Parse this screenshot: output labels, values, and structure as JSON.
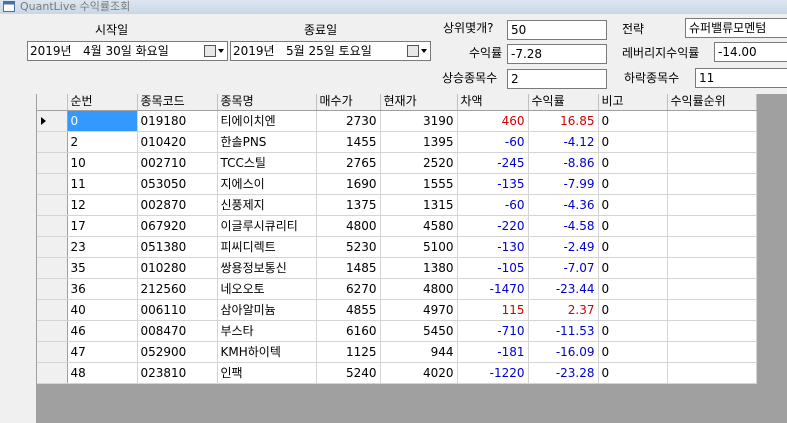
{
  "window": {
    "title": "QuantLive 수익률조회"
  },
  "form": {
    "start_label": "시작일",
    "end_label": "종료일",
    "start_date": "2019년   4월 30일 화요일",
    "end_date": "2019년   5월 25일 토요일",
    "top_n_label": "상위몇개?",
    "top_n_value": "50",
    "return_label": "수익률",
    "return_value": "-7.28",
    "rising_label": "상승종목수",
    "rising_value": "2",
    "strategy_label": "전략",
    "strategy_value": "슈퍼밸류모멘텀",
    "leverage_label": "레버리지수익률",
    "leverage_value": "-14.00",
    "falling_label": "하락종목수",
    "falling_value": "11"
  },
  "grid": {
    "columns": [
      "순번",
      "종목코드",
      "종목명",
      "매수가",
      "현재가",
      "차액",
      "수익률",
      "비고",
      "수익률순위"
    ],
    "rows": [
      {
        "no": "0",
        "code": "019180",
        "name": "티에이치엔",
        "buy": "2730",
        "cur": "3190",
        "diff": "460",
        "ret": "16.85",
        "note": "0",
        "rank": "",
        "sign": "pos"
      },
      {
        "no": "2",
        "code": "010420",
        "name": "한솔PNS",
        "buy": "1455",
        "cur": "1395",
        "diff": "-60",
        "ret": "-4.12",
        "note": "0",
        "rank": "",
        "sign": "neg"
      },
      {
        "no": "10",
        "code": "002710",
        "name": "TCC스틸",
        "buy": "2765",
        "cur": "2520",
        "diff": "-245",
        "ret": "-8.86",
        "note": "0",
        "rank": "",
        "sign": "neg"
      },
      {
        "no": "11",
        "code": "053050",
        "name": "지에스이",
        "buy": "1690",
        "cur": "1555",
        "diff": "-135",
        "ret": "-7.99",
        "note": "0",
        "rank": "",
        "sign": "neg"
      },
      {
        "no": "12",
        "code": "002870",
        "name": "신풍제지",
        "buy": "1375",
        "cur": "1315",
        "diff": "-60",
        "ret": "-4.36",
        "note": "0",
        "rank": "",
        "sign": "neg"
      },
      {
        "no": "17",
        "code": "067920",
        "name": "이글루시큐리티",
        "buy": "4800",
        "cur": "4580",
        "diff": "-220",
        "ret": "-4.58",
        "note": "0",
        "rank": "",
        "sign": "neg"
      },
      {
        "no": "23",
        "code": "051380",
        "name": "피씨디렉트",
        "buy": "5230",
        "cur": "5100",
        "diff": "-130",
        "ret": "-2.49",
        "note": "0",
        "rank": "",
        "sign": "neg"
      },
      {
        "no": "35",
        "code": "010280",
        "name": "쌍용정보통신",
        "buy": "1485",
        "cur": "1380",
        "diff": "-105",
        "ret": "-7.07",
        "note": "0",
        "rank": "",
        "sign": "neg"
      },
      {
        "no": "36",
        "code": "212560",
        "name": "네오오토",
        "buy": "6270",
        "cur": "4800",
        "diff": "-1470",
        "ret": "-23.44",
        "note": "0",
        "rank": "",
        "sign": "neg"
      },
      {
        "no": "40",
        "code": "006110",
        "name": "삼아알미늄",
        "buy": "4855",
        "cur": "4970",
        "diff": "115",
        "ret": "2.37",
        "note": "0",
        "rank": "",
        "sign": "pos"
      },
      {
        "no": "46",
        "code": "008470",
        "name": "부스타",
        "buy": "6160",
        "cur": "5450",
        "diff": "-710",
        "ret": "-11.53",
        "note": "0",
        "rank": "",
        "sign": "neg"
      },
      {
        "no": "47",
        "code": "052900",
        "name": "KMH하이텍",
        "buy": "1125",
        "cur": "944",
        "diff": "-181",
        "ret": "-16.09",
        "note": "0",
        "rank": "",
        "sign": "neg"
      },
      {
        "no": "48",
        "code": "023810",
        "name": "인팩",
        "buy": "5240",
        "cur": "4020",
        "diff": "-1220",
        "ret": "-23.28",
        "note": "0",
        "rank": "",
        "sign": "neg"
      }
    ]
  },
  "colors": {
    "positive": "#d10000",
    "negative": "#0000cc",
    "selection": "#3399ff"
  },
  "icons": {
    "app": "window-icon",
    "calendar": "calendar-icon",
    "dropdown": "chevron-down-icon",
    "row_pointer": "row-pointer-icon"
  }
}
